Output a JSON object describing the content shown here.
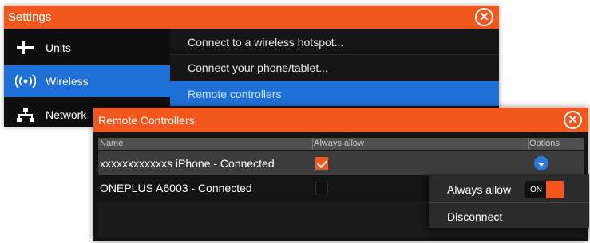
{
  "settings": {
    "title": "Settings",
    "close_icon": "close-icon",
    "sidebar": [
      {
        "label": "Units",
        "icon": "units-icon",
        "selected": false
      },
      {
        "label": "Wireless",
        "icon": "wireless-icon",
        "selected": true
      },
      {
        "label": "Network",
        "icon": "network-icon",
        "selected": false
      }
    ],
    "list": [
      {
        "label": "Connect to a wireless hotspot...",
        "selected": false
      },
      {
        "label": "Connect your phone/tablet...",
        "selected": false
      },
      {
        "label": "Remote controllers",
        "selected": true
      }
    ]
  },
  "remote": {
    "title": "Remote Controllers",
    "close_icon": "close-icon",
    "columns": [
      "Name",
      "Always allow",
      "Options"
    ],
    "rows": [
      {
        "name": "xxxxxxxxxxxxs iPhone - Connected",
        "always_allow": true,
        "selected": true
      },
      {
        "name": "ONEPLUS A6003 - Connected",
        "always_allow": false,
        "selected": false
      }
    ]
  },
  "popup": {
    "always_allow_label": "Always allow",
    "toggle_label": "ON",
    "toggle_on": true,
    "disconnect_label": "Disconnect"
  },
  "colors": {
    "accent": "#f2581e",
    "selection": "#1e6fd6",
    "background": "#141414"
  }
}
